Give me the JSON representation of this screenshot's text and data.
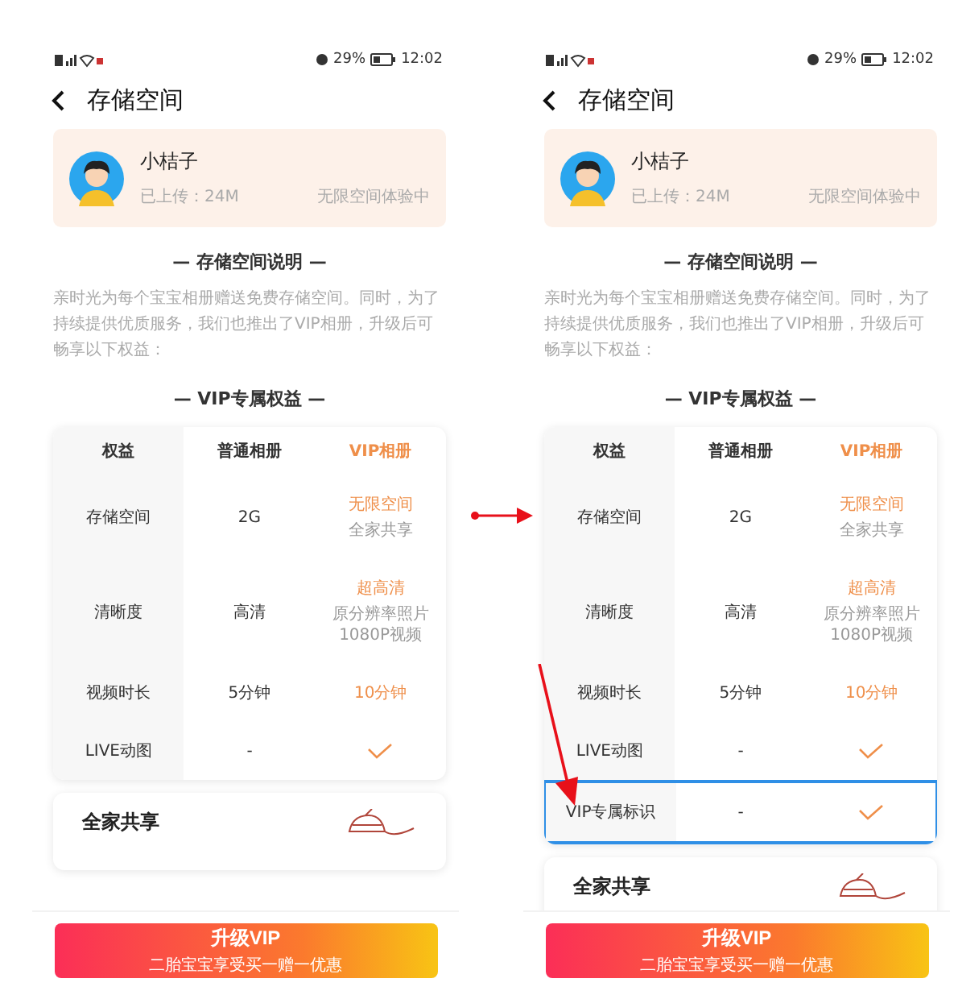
{
  "screens": [
    {
      "status_bar": {
        "battery": "29%",
        "time": "12:02"
      },
      "title": "存储空间",
      "profile": {
        "name": "小桔子",
        "uploaded": "已上传：24M",
        "status": "无限空间体验中"
      },
      "section_title": "— 存储空间说明 —",
      "description": "亲时光为每个宝宝相册赠送免费存储空间。同时，为了持续提供优质服务，我们也推出了VIP相册，升级后可畅享以下权益：",
      "vip_title": "— VIP专属权益 —",
      "table": {
        "columns": [
          "权益",
          "普通相册",
          "VIP相册"
        ],
        "rows": [
          {
            "highlighted": false,
            "cells": [
              {
                "kind": "text",
                "text": "存储空间"
              },
              {
                "kind": "text",
                "text": "2G"
              },
              {
                "kind": "text",
                "text": "无限空间",
                "sub": "全家共享"
              }
            ]
          },
          {
            "highlighted": false,
            "cells": [
              {
                "kind": "text",
                "text": "清晰度"
              },
              {
                "kind": "text",
                "text": "高清"
              },
              {
                "kind": "text",
                "text": "超高清",
                "sub": "原分辨率照片\n1080P视频"
              }
            ]
          },
          {
            "highlighted": false,
            "cells": [
              {
                "kind": "text",
                "text": "视频时长"
              },
              {
                "kind": "text",
                "text": "5分钟"
              },
              {
                "kind": "text",
                "text": "10分钟"
              }
            ]
          },
          {
            "highlighted": false,
            "cells": [
              {
                "kind": "text",
                "text": "LIVE动图"
              },
              {
                "kind": "text",
                "text": "-"
              },
              {
                "kind": "check"
              }
            ]
          }
        ]
      },
      "family_card": {
        "title": "全家共享"
      },
      "upgrade_button": {
        "label": "升级VIP",
        "sub": "二胎宝宝享受买一赠一优惠"
      }
    },
    {
      "status_bar": {
        "battery": "29%",
        "time": "12:02"
      },
      "title": "存储空间",
      "profile": {
        "name": "小桔子",
        "uploaded": "已上传：24M",
        "status": "无限空间体验中"
      },
      "section_title": "— 存储空间说明 —",
      "description": "亲时光为每个宝宝相册赠送免费存储空间。同时，为了持续提供优质服务，我们也推出了VIP相册，升级后可畅享以下权益：",
      "vip_title": "— VIP专属权益 —",
      "table": {
        "columns": [
          "权益",
          "普通相册",
          "VIP相册"
        ],
        "rows": [
          {
            "highlighted": false,
            "cells": [
              {
                "kind": "text",
                "text": "存储空间"
              },
              {
                "kind": "text",
                "text": "2G"
              },
              {
                "kind": "text",
                "text": "无限空间",
                "sub": "全家共享"
              }
            ]
          },
          {
            "highlighted": false,
            "cells": [
              {
                "kind": "text",
                "text": "清晰度"
              },
              {
                "kind": "text",
                "text": "高清"
              },
              {
                "kind": "text",
                "text": "超高清",
                "sub": "原分辨率照片\n1080P视频"
              }
            ]
          },
          {
            "highlighted": false,
            "cells": [
              {
                "kind": "text",
                "text": "视频时长"
              },
              {
                "kind": "text",
                "text": "5分钟"
              },
              {
                "kind": "text",
                "text": "10分钟"
              }
            ]
          },
          {
            "highlighted": false,
            "cells": [
              {
                "kind": "text",
                "text": "LIVE动图"
              },
              {
                "kind": "text",
                "text": "-"
              },
              {
                "kind": "check"
              }
            ]
          },
          {
            "highlighted": true,
            "cells": [
              {
                "kind": "text",
                "text": "VIP专属标识"
              },
              {
                "kind": "text",
                "text": "-"
              },
              {
                "kind": "check"
              }
            ]
          }
        ]
      },
      "family_card": {
        "title": "全家共享"
      },
      "upgrade_button": {
        "label": "升级VIP",
        "sub": "二胎宝宝享受买一赠一优惠"
      }
    }
  ]
}
